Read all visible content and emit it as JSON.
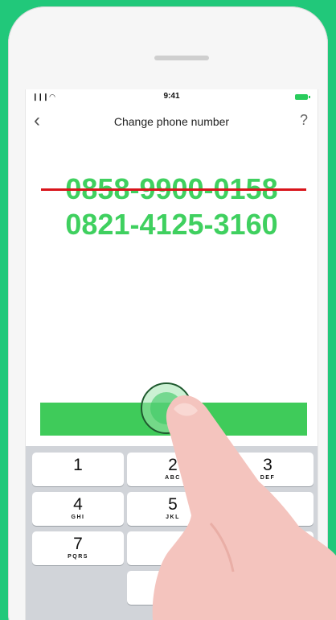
{
  "status_bar": {
    "time": "9:41",
    "signal": "❙❙❙ ◠"
  },
  "nav": {
    "back_icon": "‹",
    "title": "Change phone number",
    "help_icon": "?"
  },
  "phone": {
    "old_number": "0858-9900-0158",
    "new_number": "0821-4125-3160"
  },
  "colors": {
    "background": "#21c87a",
    "accent_green": "#3fd05f",
    "strike_red": "#d9141b",
    "button_green": "#3fcb5a",
    "skin": "#f4c4be"
  },
  "keypad": {
    "keys": [
      {
        "digit": "1",
        "letters": ""
      },
      {
        "digit": "2",
        "letters": "ABC"
      },
      {
        "digit": "3",
        "letters": "DEF"
      },
      {
        "digit": "4",
        "letters": "GHI"
      },
      {
        "digit": "5",
        "letters": "JKL"
      },
      {
        "digit": "",
        "letters": ""
      },
      {
        "digit": "7",
        "letters": "PQRS"
      },
      {
        "digit": "",
        "letters": ""
      },
      {
        "digit": "",
        "letters": ""
      },
      {
        "digit": "",
        "letters": ""
      },
      {
        "digit": "",
        "letters": ""
      }
    ]
  }
}
